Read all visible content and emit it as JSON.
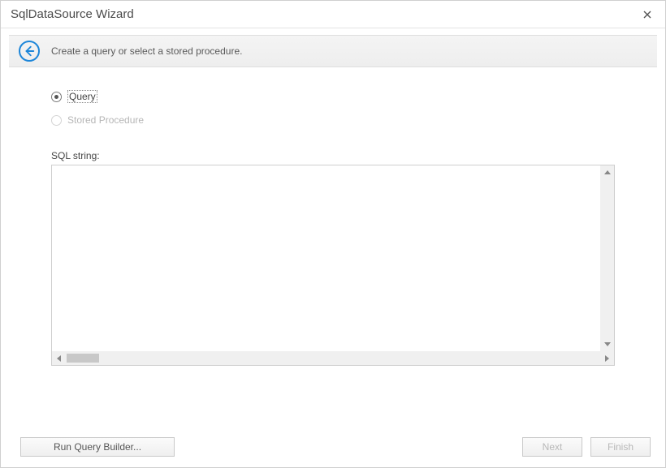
{
  "window": {
    "title": "SqlDataSource Wizard"
  },
  "header": {
    "subtitle": "Create a query or select a stored procedure."
  },
  "options": {
    "query_label": "Query",
    "stored_procedure_label": "Stored Procedure",
    "selected": "query",
    "stored_procedure_enabled": false
  },
  "sql": {
    "label": "SQL string:",
    "value": ""
  },
  "buttons": {
    "run_query_builder": "Run Query Builder...",
    "next": "Next",
    "finish": "Finish"
  }
}
